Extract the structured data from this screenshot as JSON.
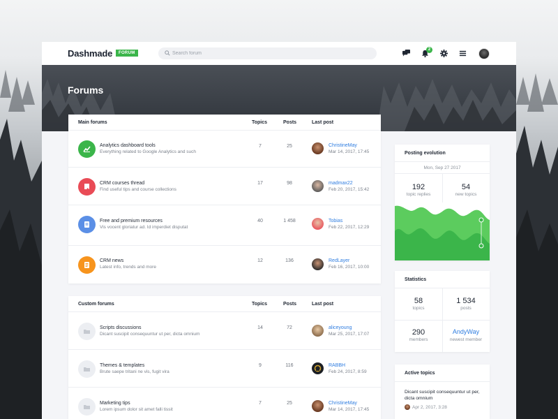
{
  "app": {
    "brand": "Dashmade",
    "badge": "FORUM",
    "search_placeholder": "Search forum",
    "notification_count": "2",
    "page_title": "Forums"
  },
  "colors": {
    "green": "#3bb54a",
    "red": "#e94b56",
    "blue": "#5b8fe6",
    "orange": "#f7941d",
    "link": "#2f7de0"
  },
  "main_forums": {
    "header": {
      "title": "Main forums",
      "topics": "Topics",
      "posts": "Posts",
      "last_post": "Last post"
    },
    "rows": [
      {
        "icon": "chart-icon",
        "title": "Analytics dashboard tools",
        "desc": "Everything related to Google Analytics and such",
        "topics": "7",
        "posts": "25",
        "user": "ChristineMay",
        "date": "Mar 14, 2017, 17:45"
      },
      {
        "icon": "book-icon",
        "title": "CRM courses thread",
        "desc": "Find useful tips and course collections",
        "topics": "17",
        "posts": "98",
        "user": "madmax22",
        "date": "Feb 20, 2017, 15:42"
      },
      {
        "icon": "badge-icon",
        "title": "Free and premium resources",
        "desc": "Vis vocent gloriatur ad. Id imperdiet disputat",
        "topics": "40",
        "posts": "1 458",
        "user": "Tobias",
        "date": "Feb 22, 2017, 12:29"
      },
      {
        "icon": "document-icon",
        "title": "CRM news",
        "desc": "Latest info, trends and more",
        "topics": "12",
        "posts": "136",
        "user": "RedLayer",
        "date": "Feb 16, 2017, 10:00"
      }
    ]
  },
  "custom_forums": {
    "header": {
      "title": "Custom forums",
      "topics": "Topics",
      "posts": "Posts",
      "last_post": "Last post"
    },
    "rows": [
      {
        "icon": "folder-icon",
        "title": "Scripts discussions",
        "desc": "Dicant suscipit consequuntur ut per, dicta omnium",
        "topics": "14",
        "posts": "72",
        "user": "aliceyoung",
        "date": "Mar 25, 2017, 17:07"
      },
      {
        "icon": "folder-icon",
        "title": "Themes & templates",
        "desc": "Brute saepe tritani ne vis, fugit vira",
        "topics": "9",
        "posts": "116",
        "user": "RABBH",
        "date": "Feb 24, 2017, 8:59"
      },
      {
        "icon": "folder-icon",
        "title": "Marketing tips",
        "desc": "Lorem ipsum dolor sit amet falli tissit",
        "topics": "7",
        "posts": "25",
        "user": "ChristineMay",
        "date": "Mar 14, 2017, 17:45"
      }
    ]
  },
  "posting_evolution": {
    "title": "Posting evolution",
    "date": "Mon, Sep 27 2017",
    "left_value": "192",
    "left_label": "topic replies",
    "right_value": "54",
    "right_label": "new topics"
  },
  "statistics": {
    "title": "Statistics",
    "topics_value": "58",
    "topics_label": "topics",
    "posts_value": "1 534",
    "posts_label": "posts",
    "members_value": "290",
    "members_label": "members",
    "newest_value": "AndyWay",
    "newest_label": "newest member"
  },
  "active_topics": {
    "title": "Active topics",
    "item_title": "Dicant suscipit consequuntur ut per, dicta omnium",
    "item_date": "Apr 2, 2017, 3:28"
  }
}
